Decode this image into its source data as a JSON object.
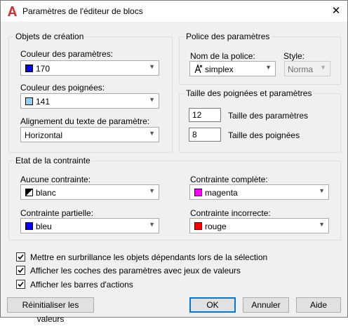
{
  "window": {
    "title": "Paramètres de l'éditeur de blocs",
    "close_glyph": "✕"
  },
  "creation": {
    "title": "Objets de création",
    "param_color": {
      "label": "Couleur des paramètres:",
      "value": "170",
      "swatch": "#0000ff"
    },
    "grip_color": {
      "label": "Couleur des poignées:",
      "value": "141",
      "swatch": "#8cd3ff"
    },
    "text_alignment": {
      "label": "Alignement du texte de paramètre:",
      "value": "Horizontal"
    }
  },
  "font": {
    "title": "Police des paramètres",
    "name_label": "Nom de la police:",
    "name_value": "simplex",
    "style_label": "Style:",
    "style_value": "Norma"
  },
  "sizes": {
    "title": "Taille des poignées et paramètres",
    "param_size": {
      "value": "12",
      "label": "Taille des paramètres"
    },
    "grip_size": {
      "value": "8",
      "label": "Taille des poignées"
    }
  },
  "constraint": {
    "title": "Etat de la contrainte",
    "none": {
      "label": "Aucune contrainte:",
      "value": "blanc",
      "swatch": "#ffffff"
    },
    "full": {
      "label": "Contrainte complète:",
      "value": "magenta",
      "swatch": "#ff00ff"
    },
    "partial": {
      "label": "Contrainte partielle:",
      "value": "bleu",
      "swatch": "#0000ff"
    },
    "incorrect": {
      "label": "Contrainte incorrecte:",
      "value": "rouge",
      "swatch": "#ff0000"
    }
  },
  "options": [
    {
      "label": "Mettre en surbrillance les objets dépendants lors de la sélection",
      "checked": true
    },
    {
      "label": "Afficher les coches des paramètres avec jeux de valeurs",
      "checked": true
    },
    {
      "label": "Afficher les barres d'actions",
      "checked": true
    }
  ],
  "buttons": {
    "reset": "Réinitialiser les valeurs",
    "ok": "OK",
    "cancel": "Annuler",
    "help": "Aide"
  },
  "colors": {
    "accent": "#0078d7",
    "app_icon": "#d32f2f"
  }
}
